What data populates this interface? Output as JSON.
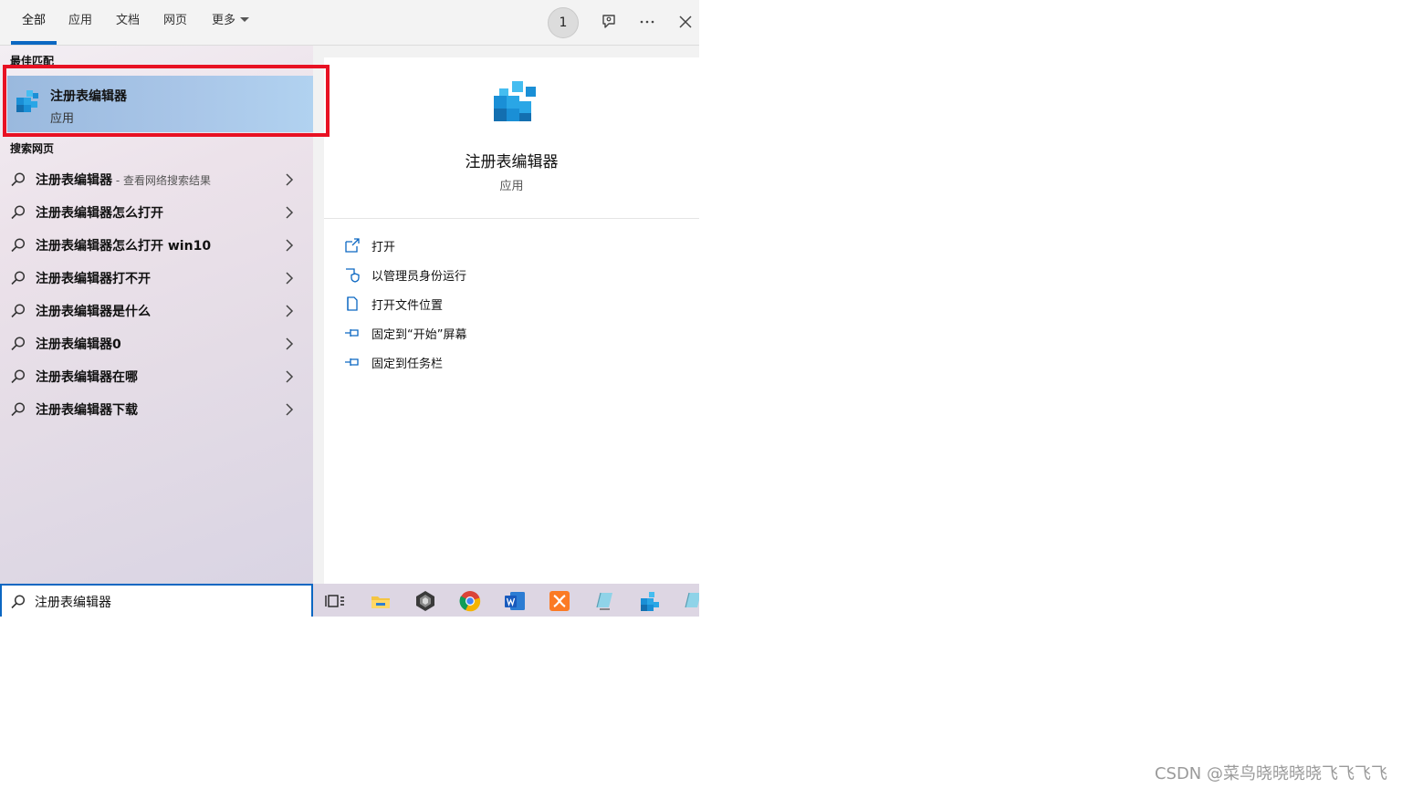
{
  "tabs": [
    {
      "label": "全部",
      "active": true
    },
    {
      "label": "应用"
    },
    {
      "label": "文档"
    },
    {
      "label": "网页"
    },
    {
      "label": "更多"
    }
  ],
  "toolbar": {
    "badge_count": "1"
  },
  "best_match": {
    "section_label": "最佳匹配",
    "title": "注册表编辑器",
    "subtitle": "应用",
    "icon": "registry-editor-icon"
  },
  "web": {
    "section_label": "搜索网页",
    "items": [
      {
        "label": "注册表编辑器",
        "suffix": " - 查看网络搜索结果"
      },
      {
        "label": "注册表编辑器怎么打开",
        "suffix": ""
      },
      {
        "label": "注册表编辑器怎么打开 win10",
        "suffix": ""
      },
      {
        "label": "注册表编辑器打不开",
        "suffix": ""
      },
      {
        "label": "注册表编辑器是什么",
        "suffix": ""
      },
      {
        "label": "注册表编辑器0",
        "suffix": ""
      },
      {
        "label": "注册表编辑器在哪",
        "suffix": ""
      },
      {
        "label": "注册表编辑器下载",
        "suffix": ""
      }
    ]
  },
  "preview": {
    "title": "注册表编辑器",
    "subtitle": "应用",
    "actions": [
      {
        "label": "打开",
        "icon": "open-icon"
      },
      {
        "label": "以管理员身份运行",
        "icon": "shield-icon"
      },
      {
        "label": "打开文件位置",
        "icon": "file-location-icon"
      },
      {
        "label": "固定到“开始”屏幕",
        "icon": "pin-icon"
      },
      {
        "label": "固定到任务栏",
        "icon": "pin-icon"
      }
    ]
  },
  "search": {
    "value": "注册表编辑器"
  },
  "taskbar": {
    "icons": [
      "task-view-icon",
      "file-explorer-icon",
      "app-icon",
      "chrome-icon",
      "word-icon",
      "xampp-icon",
      "notepad-icon",
      "registry-editor-icon",
      "notepad-icon"
    ]
  },
  "watermark": "CSDN @菜鸟晓晓晓晓飞飞飞飞",
  "colors": {
    "accent": "#0b67c2",
    "highlight": "#e81123"
  }
}
